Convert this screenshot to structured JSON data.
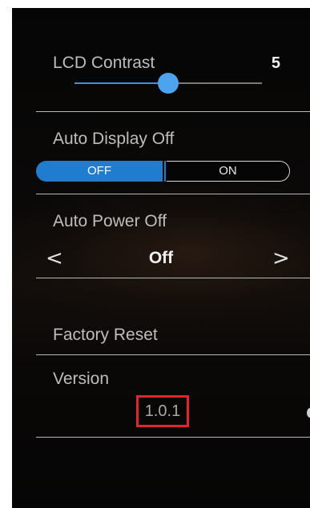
{
  "lcd_contrast": {
    "label": "LCD Contrast",
    "value": "5",
    "slider_fraction": 0.5
  },
  "auto_display_off": {
    "label": "Auto Display Off",
    "options": [
      "OFF",
      "ON"
    ],
    "selected": "OFF"
  },
  "auto_power_off": {
    "label": "Auto Power Off",
    "value": "Off",
    "prev_arrow": "<",
    "next_arrow": ">"
  },
  "factory_reset": {
    "label": "Factory Reset"
  },
  "version": {
    "label": "Version",
    "value": "1.0.1"
  },
  "colors": {
    "accent": "#1f7ccf",
    "slider_thumb": "#4ea3ef",
    "highlight_box": "#e0262b"
  }
}
